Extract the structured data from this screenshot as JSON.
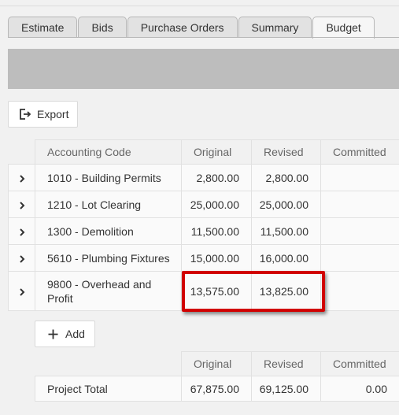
{
  "tabs": [
    {
      "label": "Estimate",
      "active": false
    },
    {
      "label": "Bids",
      "active": false
    },
    {
      "label": "Purchase Orders",
      "active": false
    },
    {
      "label": "Summary",
      "active": false
    },
    {
      "label": "Budget",
      "active": true
    }
  ],
  "toolbar": {
    "export_label": "Export",
    "export_icon": "export-icon"
  },
  "table": {
    "columns": [
      "Accounting Code",
      "Original",
      "Revised",
      "Committed"
    ],
    "rows": [
      {
        "code": "1010 - Building Permits",
        "original": "2,800.00",
        "revised": "2,800.00",
        "committed": ""
      },
      {
        "code": "1210 - Lot Clearing",
        "original": "25,000.00",
        "revised": "25,000.00",
        "committed": ""
      },
      {
        "code": "1300 - Demolition",
        "original": "11,500.00",
        "revised": "11,500.00",
        "committed": ""
      },
      {
        "code": "5610 - Plumbing Fixtures",
        "original": "15,000.00",
        "revised": "16,000.00",
        "committed": ""
      },
      {
        "code": "9800 - Overhead and Profit",
        "original": "13,575.00",
        "revised": "13,825.00",
        "committed": ""
      }
    ]
  },
  "add_label": "Add",
  "totals": {
    "columns": [
      "Original",
      "Revised",
      "Committed"
    ],
    "label": "Project Total",
    "original": "67,875.00",
    "revised": "69,125.00",
    "committed": "0.00"
  },
  "colors": {
    "highlight": "#d10000",
    "band": "#bdbdbd"
  }
}
